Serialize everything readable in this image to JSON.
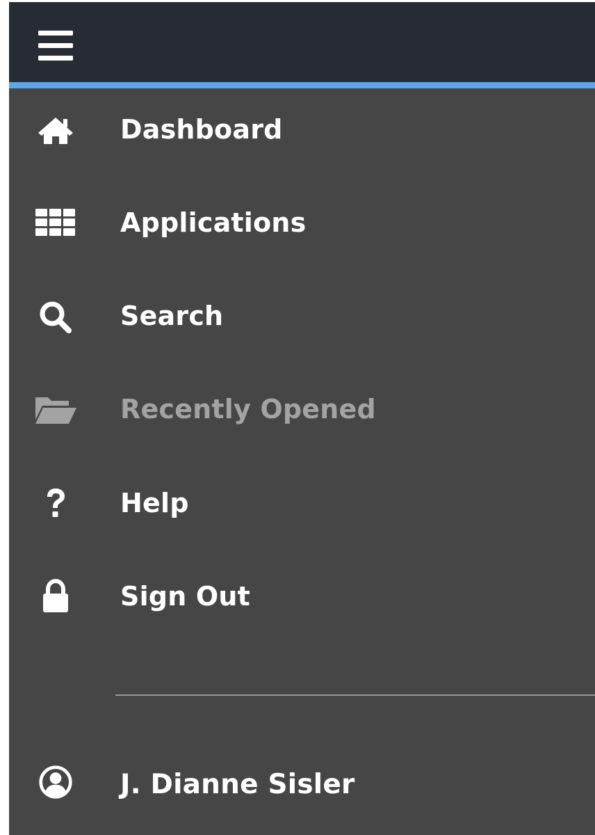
{
  "colors": {
    "topbar": "#272c34",
    "accent": "#5aa9ec",
    "panel": "#464646",
    "text": "#ffffff",
    "disabled_text": "#a3a3a3"
  },
  "topbar": {
    "menu_icon": "hamburger-icon"
  },
  "menu": {
    "items": [
      {
        "label": "Dashboard",
        "icon": "home-icon",
        "enabled": true
      },
      {
        "label": "Applications",
        "icon": "grid-icon",
        "enabled": true
      },
      {
        "label": "Search",
        "icon": "search-icon",
        "enabled": true
      },
      {
        "label": "Recently Opened",
        "icon": "folder-open-icon",
        "enabled": false
      },
      {
        "label": "Help",
        "icon": "question-icon",
        "enabled": true
      },
      {
        "label": "Sign Out",
        "icon": "lock-icon",
        "enabled": true
      }
    ]
  },
  "user": {
    "name": "J. Dianne Sisler",
    "icon": "user-circle-icon"
  }
}
